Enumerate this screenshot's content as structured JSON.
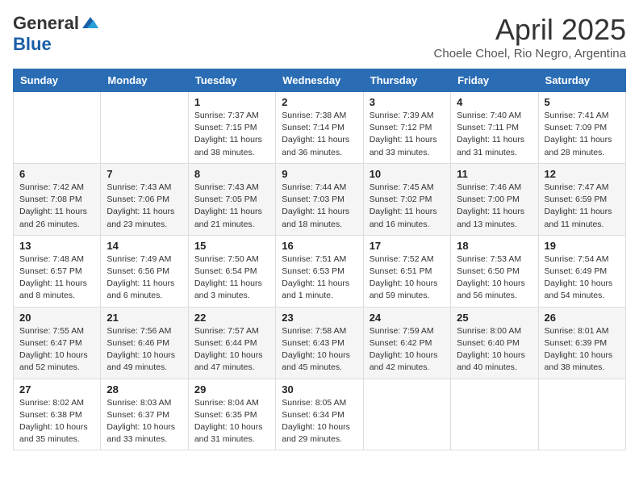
{
  "header": {
    "logo_general": "General",
    "logo_blue": "Blue",
    "title": "April 2025",
    "subtitle": "Choele Choel, Rio Negro, Argentina"
  },
  "weekdays": [
    "Sunday",
    "Monday",
    "Tuesday",
    "Wednesday",
    "Thursday",
    "Friday",
    "Saturday"
  ],
  "weeks": [
    [
      {
        "day": "",
        "info": ""
      },
      {
        "day": "",
        "info": ""
      },
      {
        "day": "1",
        "info": "Sunrise: 7:37 AM\nSunset: 7:15 PM\nDaylight: 11 hours and 38 minutes."
      },
      {
        "day": "2",
        "info": "Sunrise: 7:38 AM\nSunset: 7:14 PM\nDaylight: 11 hours and 36 minutes."
      },
      {
        "day": "3",
        "info": "Sunrise: 7:39 AM\nSunset: 7:12 PM\nDaylight: 11 hours and 33 minutes."
      },
      {
        "day": "4",
        "info": "Sunrise: 7:40 AM\nSunset: 7:11 PM\nDaylight: 11 hours and 31 minutes."
      },
      {
        "day": "5",
        "info": "Sunrise: 7:41 AM\nSunset: 7:09 PM\nDaylight: 11 hours and 28 minutes."
      }
    ],
    [
      {
        "day": "6",
        "info": "Sunrise: 7:42 AM\nSunset: 7:08 PM\nDaylight: 11 hours and 26 minutes."
      },
      {
        "day": "7",
        "info": "Sunrise: 7:43 AM\nSunset: 7:06 PM\nDaylight: 11 hours and 23 minutes."
      },
      {
        "day": "8",
        "info": "Sunrise: 7:43 AM\nSunset: 7:05 PM\nDaylight: 11 hours and 21 minutes."
      },
      {
        "day": "9",
        "info": "Sunrise: 7:44 AM\nSunset: 7:03 PM\nDaylight: 11 hours and 18 minutes."
      },
      {
        "day": "10",
        "info": "Sunrise: 7:45 AM\nSunset: 7:02 PM\nDaylight: 11 hours and 16 minutes."
      },
      {
        "day": "11",
        "info": "Sunrise: 7:46 AM\nSunset: 7:00 PM\nDaylight: 11 hours and 13 minutes."
      },
      {
        "day": "12",
        "info": "Sunrise: 7:47 AM\nSunset: 6:59 PM\nDaylight: 11 hours and 11 minutes."
      }
    ],
    [
      {
        "day": "13",
        "info": "Sunrise: 7:48 AM\nSunset: 6:57 PM\nDaylight: 11 hours and 8 minutes."
      },
      {
        "day": "14",
        "info": "Sunrise: 7:49 AM\nSunset: 6:56 PM\nDaylight: 11 hours and 6 minutes."
      },
      {
        "day": "15",
        "info": "Sunrise: 7:50 AM\nSunset: 6:54 PM\nDaylight: 11 hours and 3 minutes."
      },
      {
        "day": "16",
        "info": "Sunrise: 7:51 AM\nSunset: 6:53 PM\nDaylight: 11 hours and 1 minute."
      },
      {
        "day": "17",
        "info": "Sunrise: 7:52 AM\nSunset: 6:51 PM\nDaylight: 10 hours and 59 minutes."
      },
      {
        "day": "18",
        "info": "Sunrise: 7:53 AM\nSunset: 6:50 PM\nDaylight: 10 hours and 56 minutes."
      },
      {
        "day": "19",
        "info": "Sunrise: 7:54 AM\nSunset: 6:49 PM\nDaylight: 10 hours and 54 minutes."
      }
    ],
    [
      {
        "day": "20",
        "info": "Sunrise: 7:55 AM\nSunset: 6:47 PM\nDaylight: 10 hours and 52 minutes."
      },
      {
        "day": "21",
        "info": "Sunrise: 7:56 AM\nSunset: 6:46 PM\nDaylight: 10 hours and 49 minutes."
      },
      {
        "day": "22",
        "info": "Sunrise: 7:57 AM\nSunset: 6:44 PM\nDaylight: 10 hours and 47 minutes."
      },
      {
        "day": "23",
        "info": "Sunrise: 7:58 AM\nSunset: 6:43 PM\nDaylight: 10 hours and 45 minutes."
      },
      {
        "day": "24",
        "info": "Sunrise: 7:59 AM\nSunset: 6:42 PM\nDaylight: 10 hours and 42 minutes."
      },
      {
        "day": "25",
        "info": "Sunrise: 8:00 AM\nSunset: 6:40 PM\nDaylight: 10 hours and 40 minutes."
      },
      {
        "day": "26",
        "info": "Sunrise: 8:01 AM\nSunset: 6:39 PM\nDaylight: 10 hours and 38 minutes."
      }
    ],
    [
      {
        "day": "27",
        "info": "Sunrise: 8:02 AM\nSunset: 6:38 PM\nDaylight: 10 hours and 35 minutes."
      },
      {
        "day": "28",
        "info": "Sunrise: 8:03 AM\nSunset: 6:37 PM\nDaylight: 10 hours and 33 minutes."
      },
      {
        "day": "29",
        "info": "Sunrise: 8:04 AM\nSunset: 6:35 PM\nDaylight: 10 hours and 31 minutes."
      },
      {
        "day": "30",
        "info": "Sunrise: 8:05 AM\nSunset: 6:34 PM\nDaylight: 10 hours and 29 minutes."
      },
      {
        "day": "",
        "info": ""
      },
      {
        "day": "",
        "info": ""
      },
      {
        "day": "",
        "info": ""
      }
    ]
  ]
}
